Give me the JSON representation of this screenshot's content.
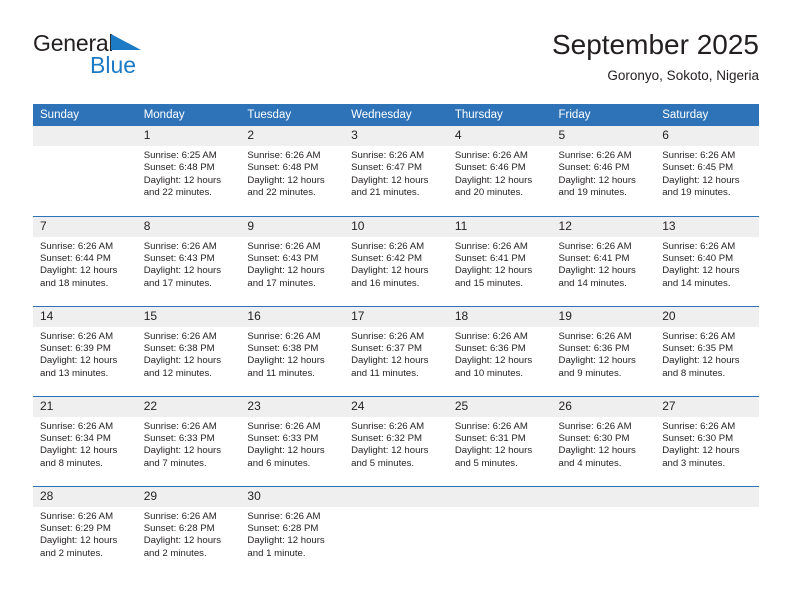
{
  "brand": {
    "name_part1": "General",
    "name_part2": "Blue",
    "triangle_icon": "triangle-icon",
    "colors": {
      "accent_blue": "#1d7ac4",
      "header_blue": "#2e73b8",
      "daynum_gray": "#efefef",
      "text": "#231f20"
    }
  },
  "header": {
    "title": "September 2025",
    "subtitle": "Goronyo, Sokoto, Nigeria"
  },
  "calendar": {
    "weekday_headers": [
      "Sunday",
      "Monday",
      "Tuesday",
      "Wednesday",
      "Thursday",
      "Friday",
      "Saturday"
    ],
    "labels": {
      "sunrise": "Sunrise:",
      "sunset": "Sunset:",
      "daylight": "Daylight:"
    },
    "weeks": [
      [
        {
          "day": "",
          "empty": true
        },
        {
          "day": "1",
          "sunrise": "Sunrise: 6:25 AM",
          "sunset": "Sunset: 6:48 PM",
          "daylight_1": "Daylight: 12 hours",
          "daylight_2": "and 22 minutes."
        },
        {
          "day": "2",
          "sunrise": "Sunrise: 6:26 AM",
          "sunset": "Sunset: 6:48 PM",
          "daylight_1": "Daylight: 12 hours",
          "daylight_2": "and 22 minutes."
        },
        {
          "day": "3",
          "sunrise": "Sunrise: 6:26 AM",
          "sunset": "Sunset: 6:47 PM",
          "daylight_1": "Daylight: 12 hours",
          "daylight_2": "and 21 minutes."
        },
        {
          "day": "4",
          "sunrise": "Sunrise: 6:26 AM",
          "sunset": "Sunset: 6:46 PM",
          "daylight_1": "Daylight: 12 hours",
          "daylight_2": "and 20 minutes."
        },
        {
          "day": "5",
          "sunrise": "Sunrise: 6:26 AM",
          "sunset": "Sunset: 6:46 PM",
          "daylight_1": "Daylight: 12 hours",
          "daylight_2": "and 19 minutes."
        },
        {
          "day": "6",
          "sunrise": "Sunrise: 6:26 AM",
          "sunset": "Sunset: 6:45 PM",
          "daylight_1": "Daylight: 12 hours",
          "daylight_2": "and 19 minutes."
        }
      ],
      [
        {
          "day": "7",
          "sunrise": "Sunrise: 6:26 AM",
          "sunset": "Sunset: 6:44 PM",
          "daylight_1": "Daylight: 12 hours",
          "daylight_2": "and 18 minutes."
        },
        {
          "day": "8",
          "sunrise": "Sunrise: 6:26 AM",
          "sunset": "Sunset: 6:43 PM",
          "daylight_1": "Daylight: 12 hours",
          "daylight_2": "and 17 minutes."
        },
        {
          "day": "9",
          "sunrise": "Sunrise: 6:26 AM",
          "sunset": "Sunset: 6:43 PM",
          "daylight_1": "Daylight: 12 hours",
          "daylight_2": "and 17 minutes."
        },
        {
          "day": "10",
          "sunrise": "Sunrise: 6:26 AM",
          "sunset": "Sunset: 6:42 PM",
          "daylight_1": "Daylight: 12 hours",
          "daylight_2": "and 16 minutes."
        },
        {
          "day": "11",
          "sunrise": "Sunrise: 6:26 AM",
          "sunset": "Sunset: 6:41 PM",
          "daylight_1": "Daylight: 12 hours",
          "daylight_2": "and 15 minutes."
        },
        {
          "day": "12",
          "sunrise": "Sunrise: 6:26 AM",
          "sunset": "Sunset: 6:41 PM",
          "daylight_1": "Daylight: 12 hours",
          "daylight_2": "and 14 minutes."
        },
        {
          "day": "13",
          "sunrise": "Sunrise: 6:26 AM",
          "sunset": "Sunset: 6:40 PM",
          "daylight_1": "Daylight: 12 hours",
          "daylight_2": "and 14 minutes."
        }
      ],
      [
        {
          "day": "14",
          "sunrise": "Sunrise: 6:26 AM",
          "sunset": "Sunset: 6:39 PM",
          "daylight_1": "Daylight: 12 hours",
          "daylight_2": "and 13 minutes."
        },
        {
          "day": "15",
          "sunrise": "Sunrise: 6:26 AM",
          "sunset": "Sunset: 6:38 PM",
          "daylight_1": "Daylight: 12 hours",
          "daylight_2": "and 12 minutes."
        },
        {
          "day": "16",
          "sunrise": "Sunrise: 6:26 AM",
          "sunset": "Sunset: 6:38 PM",
          "daylight_1": "Daylight: 12 hours",
          "daylight_2": "and 11 minutes."
        },
        {
          "day": "17",
          "sunrise": "Sunrise: 6:26 AM",
          "sunset": "Sunset: 6:37 PM",
          "daylight_1": "Daylight: 12 hours",
          "daylight_2": "and 11 minutes."
        },
        {
          "day": "18",
          "sunrise": "Sunrise: 6:26 AM",
          "sunset": "Sunset: 6:36 PM",
          "daylight_1": "Daylight: 12 hours",
          "daylight_2": "and 10 minutes."
        },
        {
          "day": "19",
          "sunrise": "Sunrise: 6:26 AM",
          "sunset": "Sunset: 6:36 PM",
          "daylight_1": "Daylight: 12 hours",
          "daylight_2": "and 9 minutes."
        },
        {
          "day": "20",
          "sunrise": "Sunrise: 6:26 AM",
          "sunset": "Sunset: 6:35 PM",
          "daylight_1": "Daylight: 12 hours",
          "daylight_2": "and 8 minutes."
        }
      ],
      [
        {
          "day": "21",
          "sunrise": "Sunrise: 6:26 AM",
          "sunset": "Sunset: 6:34 PM",
          "daylight_1": "Daylight: 12 hours",
          "daylight_2": "and 8 minutes."
        },
        {
          "day": "22",
          "sunrise": "Sunrise: 6:26 AM",
          "sunset": "Sunset: 6:33 PM",
          "daylight_1": "Daylight: 12 hours",
          "daylight_2": "and 7 minutes."
        },
        {
          "day": "23",
          "sunrise": "Sunrise: 6:26 AM",
          "sunset": "Sunset: 6:33 PM",
          "daylight_1": "Daylight: 12 hours",
          "daylight_2": "and 6 minutes."
        },
        {
          "day": "24",
          "sunrise": "Sunrise: 6:26 AM",
          "sunset": "Sunset: 6:32 PM",
          "daylight_1": "Daylight: 12 hours",
          "daylight_2": "and 5 minutes."
        },
        {
          "day": "25",
          "sunrise": "Sunrise: 6:26 AM",
          "sunset": "Sunset: 6:31 PM",
          "daylight_1": "Daylight: 12 hours",
          "daylight_2": "and 5 minutes."
        },
        {
          "day": "26",
          "sunrise": "Sunrise: 6:26 AM",
          "sunset": "Sunset: 6:30 PM",
          "daylight_1": "Daylight: 12 hours",
          "daylight_2": "and 4 minutes."
        },
        {
          "day": "27",
          "sunrise": "Sunrise: 6:26 AM",
          "sunset": "Sunset: 6:30 PM",
          "daylight_1": "Daylight: 12 hours",
          "daylight_2": "and 3 minutes."
        }
      ],
      [
        {
          "day": "28",
          "sunrise": "Sunrise: 6:26 AM",
          "sunset": "Sunset: 6:29 PM",
          "daylight_1": "Daylight: 12 hours",
          "daylight_2": "and 2 minutes."
        },
        {
          "day": "29",
          "sunrise": "Sunrise: 6:26 AM",
          "sunset": "Sunset: 6:28 PM",
          "daylight_1": "Daylight: 12 hours",
          "daylight_2": "and 2 minutes."
        },
        {
          "day": "30",
          "sunrise": "Sunrise: 6:26 AM",
          "sunset": "Sunset: 6:28 PM",
          "daylight_1": "Daylight: 12 hours",
          "daylight_2": "and 1 minute."
        },
        {
          "day": "",
          "empty": true
        },
        {
          "day": "",
          "empty": true
        },
        {
          "day": "",
          "empty": true
        },
        {
          "day": "",
          "empty": true
        }
      ]
    ]
  }
}
